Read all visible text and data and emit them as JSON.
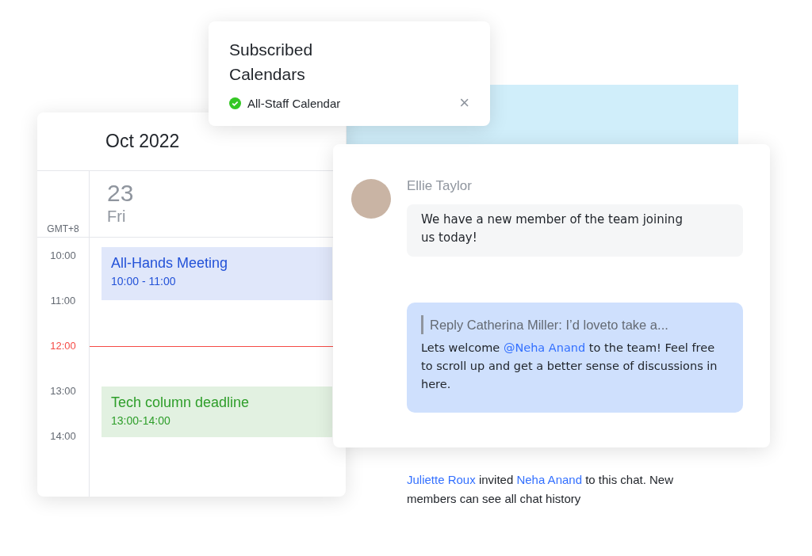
{
  "subscribed_calendars": {
    "title": "Subscribed Calendars",
    "items": [
      {
        "label": "All-Staff Calendar",
        "checked": true,
        "close": "×"
      }
    ]
  },
  "calendar": {
    "month": "Oct 2022",
    "timezone": "GMT+8",
    "day_number": "23",
    "weekday": "Fri",
    "hours": [
      {
        "label": "10:00",
        "current": false
      },
      {
        "label": "11:00",
        "current": false
      },
      {
        "label": "12:00",
        "current": true
      },
      {
        "label": "13:00",
        "current": false
      },
      {
        "label": "14:00",
        "current": false
      }
    ],
    "events": [
      {
        "title": "All-Hands Meeting",
        "time": "10:00 - 11:00",
        "color": "#2352d8"
      },
      {
        "title": "Tech column deadline",
        "time": "13:00-14:00",
        "color": "#2e9e2a"
      }
    ]
  },
  "chat": {
    "sender": "Ellie Taylor",
    "message": "We have a new member of the team joining us today!",
    "reply_quote": "Reply Catherina Miller: I’d loveto take a...",
    "reply_parts": [
      {
        "kind": "text",
        "text": "Lets welcome "
      },
      {
        "kind": "mention",
        "text": "@Neha Anand"
      },
      {
        "kind": "text",
        "text": " to the team! Feel free to scroll up and get a better sense of discussions in here."
      }
    ]
  },
  "system_message": [
    {
      "kind": "link",
      "text": "Juliette Roux"
    },
    {
      "kind": "text",
      "text": " invited "
    },
    {
      "kind": "link",
      "text": "Neha Anand"
    },
    {
      "kind": "text",
      "text": " to this chat. New members can see all chat history"
    }
  ]
}
